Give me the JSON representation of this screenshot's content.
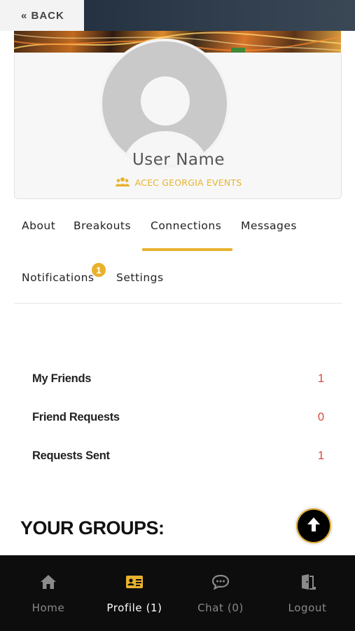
{
  "header": {
    "back_label": "« BACK"
  },
  "profile": {
    "user_name": "User Name",
    "group_name": "ACEC GEORGIA EVENTS",
    "accent_color": "#e8b22d"
  },
  "tabs": {
    "items": [
      {
        "label": "About",
        "active": false
      },
      {
        "label": "Breakouts",
        "active": false
      },
      {
        "label": "Connections",
        "active": true
      },
      {
        "label": "Messages",
        "active": false
      },
      {
        "label": "Notifications",
        "active": false,
        "badge": "1"
      },
      {
        "label": "Settings",
        "active": false
      }
    ]
  },
  "connections": {
    "rows": [
      {
        "label": "My Friends",
        "count": "1"
      },
      {
        "label": "Friend Requests",
        "count": "0"
      },
      {
        "label": "Requests Sent",
        "count": "1"
      }
    ],
    "count_color": "#d9473b"
  },
  "groups": {
    "title": "YOUR GROUPS:"
  },
  "scroll_top": {
    "icon": "arrow-up-icon"
  },
  "bottom_nav": {
    "items": [
      {
        "label": "Home",
        "icon": "home-icon",
        "active": false
      },
      {
        "label": "Profile (1)",
        "icon": "id-card-icon",
        "active": true
      },
      {
        "label": "Chat (0)",
        "icon": "chat-bubble-icon",
        "active": false
      },
      {
        "label": "Logout",
        "icon": "door-exit-icon",
        "active": false
      }
    ]
  }
}
